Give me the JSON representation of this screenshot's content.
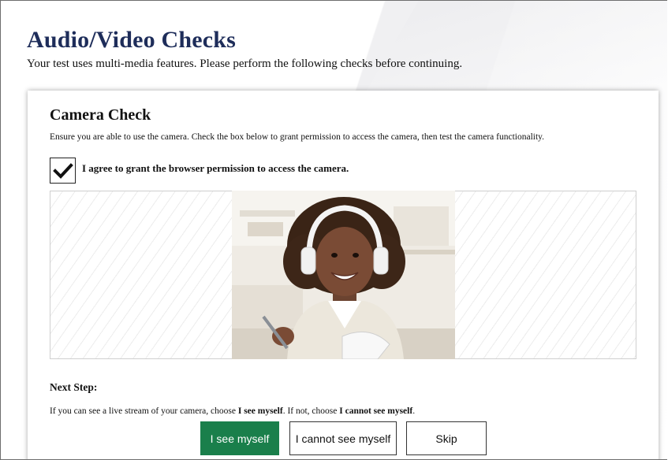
{
  "page": {
    "title": "Audio/Video Checks",
    "subtitle": "Your test uses multi-media features. Please perform the following checks before continuing."
  },
  "camera_check": {
    "title": "Camera Check",
    "description": "Ensure you are able to use the camera. Check the box below to grant permission to access the camera, then test the camera functionality.",
    "consent_label": "I agree to grant the browser permission to access the camera.",
    "consent_checked": true
  },
  "next_step": {
    "title": "Next Step:",
    "text_prefix": "If you can see a live stream of your camera, choose ",
    "option_yes": "I see myself",
    "text_middle": ". If not, choose ",
    "option_no": "I cannot see myself",
    "text_suffix": "."
  },
  "buttons": {
    "see_myself": "I see myself",
    "cannot_see_myself": "I cannot see myself",
    "skip": "Skip"
  },
  "colors": {
    "title": "#1e2d5a",
    "primary_button": "#1a7f4b"
  },
  "icons": {
    "checkbox": "checkmark-icon"
  }
}
